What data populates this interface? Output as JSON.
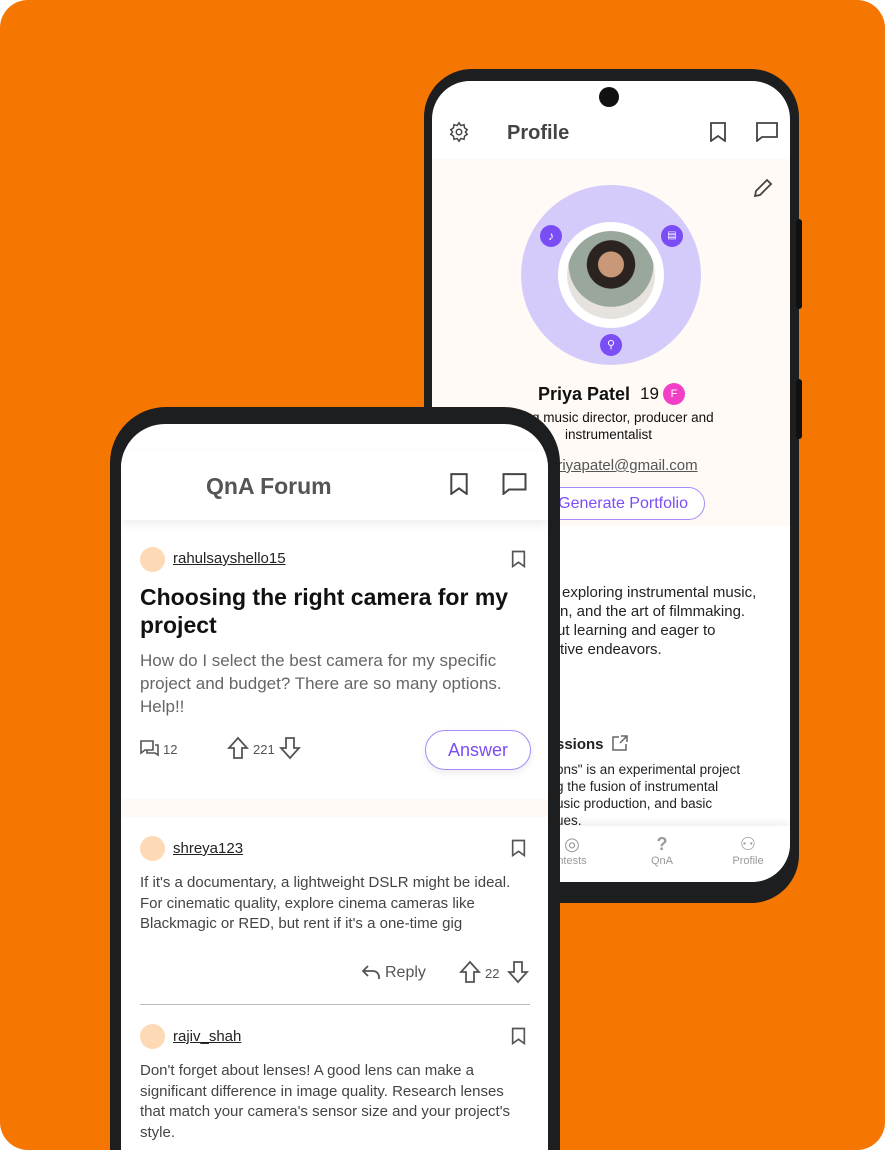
{
  "colors": {
    "background": "#F57600",
    "accent": "#7B4DF5",
    "ring": "#D5CBFB",
    "avatar": "#FDD9B5",
    "badge": "#F23FC6"
  },
  "profile": {
    "title": "Profile",
    "name": "Priya Patel",
    "age": "19",
    "gender_badge": "F",
    "tagline_1": "g music director, producer and",
    "tagline_2": "instrumentalist",
    "email": "priyapatel@gmail.com",
    "generate_button": "Generate Portfolio",
    "bio": [
      "exploring instrumental music,",
      "n, and the art of filmmaking.",
      "ut learning and eager to",
      "tive endeavors."
    ],
    "project_title": "ssions",
    "project_desc": [
      "ons\" is an experimental project",
      "g the fusion of instrumental",
      "usic production, and basic",
      "ues."
    ],
    "nav": [
      {
        "label": "ntests",
        "icon": "award-icon"
      },
      {
        "label": "QnA",
        "icon": "question-icon"
      },
      {
        "label": "Profile",
        "icon": "user-icon"
      }
    ]
  },
  "forum": {
    "title": "QnA Forum",
    "question": {
      "user": "rahulsayshello15",
      "title": "Choosing the right camera for my project",
      "body": "How do I select the best camera for my specific project and budget? There are so many options. Help!!",
      "comments": "12",
      "votes": "221",
      "answer_button": "Answer"
    },
    "answers": [
      {
        "user": "shreya123",
        "body": "If it's a documentary, a lightweight DSLR might be ideal. For cinematic quality, explore cinema cameras like Blackmagic or RED, but rent if it's a one-time gig",
        "reply": "Reply",
        "votes": "22"
      },
      {
        "user": "rajiv_shah",
        "body": "Don't forget about lenses! A good lens can make a significant difference in image quality. Research lenses that match your camera's sensor size and your project's style."
      }
    ]
  }
}
